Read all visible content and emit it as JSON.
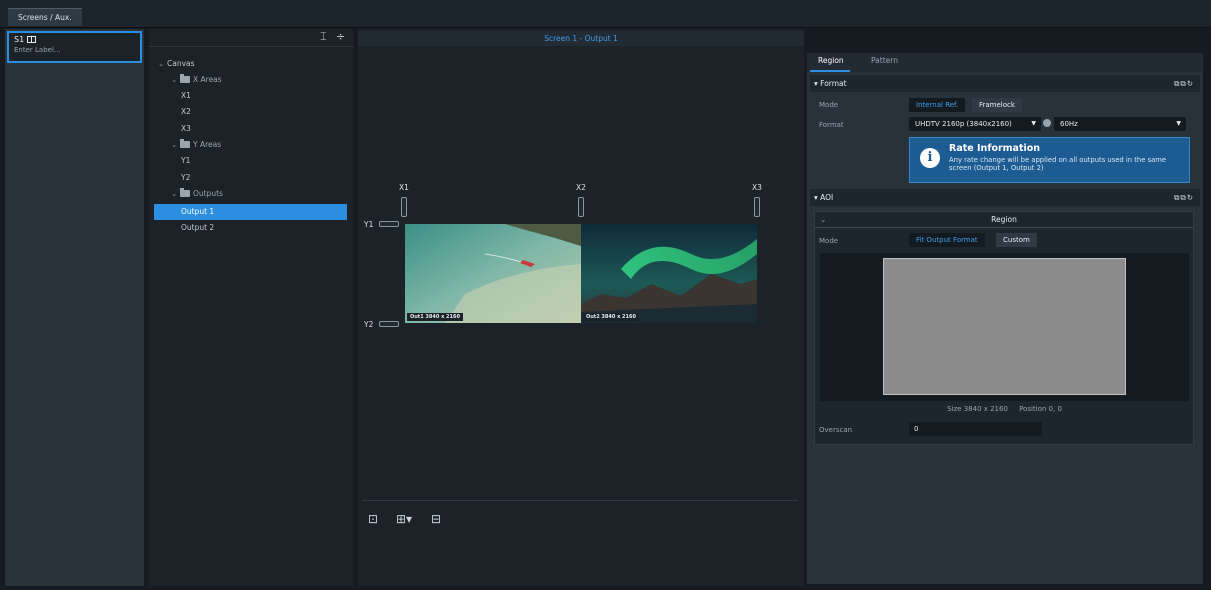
{
  "tabs": {
    "screens_aux": "Screens / Aux."
  },
  "screen_list": {
    "id": "S1",
    "placeholder": "Enter Label..."
  },
  "tree": {
    "canvas": "Canvas",
    "x_areas": "X Areas",
    "x_items": [
      "X1",
      "X2",
      "X3"
    ],
    "y_areas": "Y Areas",
    "y_items": [
      "Y1",
      "Y2"
    ],
    "outputs": "Outputs",
    "output_items": [
      "Output 1",
      "Output 2"
    ],
    "selected": "Output 1"
  },
  "canvas": {
    "title": "Screen 1 - Output 1",
    "x_labels": [
      "X1",
      "X2",
      "X3"
    ],
    "y_labels": [
      "Y1",
      "Y2"
    ],
    "outputs": [
      {
        "tag": "Out1 3840 x 2160"
      },
      {
        "tag": "Out2 3840 x 2160"
      }
    ]
  },
  "right": {
    "tabs": [
      "Region",
      "Pattern"
    ],
    "active_tab": "Region",
    "format": {
      "header": "Format",
      "mode_label": "Mode",
      "mode_options": [
        "Internal Ref.",
        "Framelock"
      ],
      "mode_selected": "Internal Ref.",
      "format_label": "Format",
      "format_value": "UHDTV 2160p (3840x2160)",
      "rate_value": "60Hz"
    },
    "info": {
      "title": "Rate Information",
      "body": "Any rate change will be applied on all outputs used in the same screen (Output 1, Output 2)"
    },
    "aoi": {
      "header": "AOI",
      "region_header": "Region",
      "mode_label": "Mode",
      "mode_options": [
        "Fit Output Format",
        "Custom"
      ],
      "mode_selected": "Fit Output Format",
      "size": "Size 3840 x 2160",
      "position": "Position 0, 0",
      "overscan_label": "Overscan",
      "overscan_value": "0"
    }
  },
  "colors": {
    "accent": "#2b8ee0",
    "info_bg": "#1d5c93"
  }
}
